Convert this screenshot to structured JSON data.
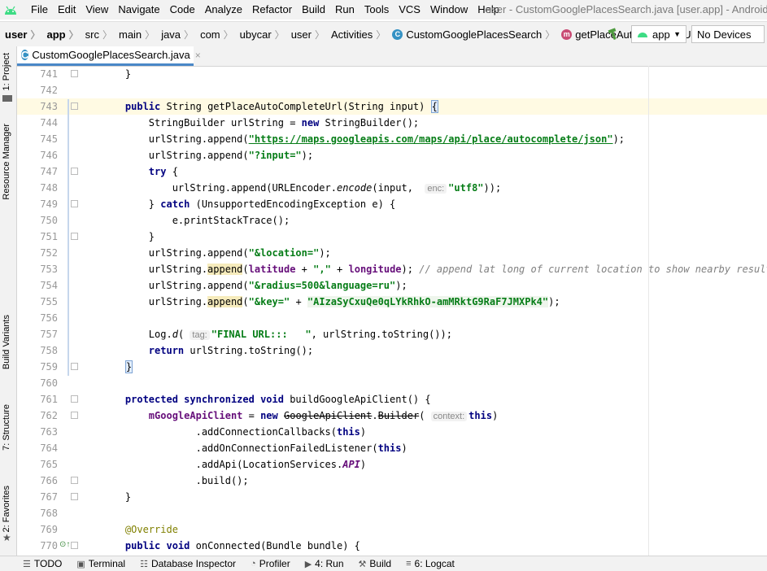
{
  "menu": {
    "items": [
      "File",
      "Edit",
      "View",
      "Navigate",
      "Code",
      "Analyze",
      "Refactor",
      "Build",
      "Run",
      "Tools",
      "VCS",
      "Window",
      "Help"
    ],
    "window_title": "user - CustomGooglePlacesSearch.java [user.app] - Android Studio"
  },
  "breadcrumb": {
    "items": [
      "user",
      "app",
      "src",
      "main",
      "java",
      "com",
      "ubycar",
      "user",
      "Activities",
      "CustomGooglePlacesSearch",
      "getPlaceAutoCompleteUrl"
    ]
  },
  "toolbar": {
    "run_config": "app",
    "device": "No Devices"
  },
  "editor_tab": {
    "label": "CustomGooglePlacesSearch.java",
    "close": "×"
  },
  "left_strip": {
    "project": "1: Project",
    "resource_manager": "Resource Manager",
    "build_variants": "Build Variants",
    "structure": "7: Structure",
    "favorites": "2: Favorites"
  },
  "code": {
    "line_numbers": [
      "741",
      "742",
      "743",
      "744",
      "745",
      "746",
      "747",
      "748",
      "749",
      "750",
      "751",
      "752",
      "753",
      "754",
      "755",
      "756",
      "757",
      "758",
      "759",
      "760",
      "761",
      "762",
      "763",
      "764",
      "765",
      "766",
      "767",
      "768",
      "769",
      "770"
    ],
    "s_url": "\"https://maps.googleapis.com/maps/api/place/autocomplete/json\"",
    "s_input": "\"?input=\"",
    "s_utf8": "\"utf8\"",
    "s_location": "\"&location=\"",
    "s_comma": "\",\"",
    "comment_753": "// append lat long of current location to show nearby results.",
    "s_radius": "\"&radius=500&language=ru\"",
    "s_key": "\"&key=\"",
    "s_apikey": "\"AIzaSyCxuQe0qLYkRhkO-amMRktG9RaF7JMXPk4\"",
    "s_final": "\"FINAL URL:::   \"",
    "hint_enc": "enc:",
    "hint_tag": "tag:",
    "hint_context": "context:"
  },
  "status": {
    "todo": "TODO",
    "terminal": "Terminal",
    "database": "Database Inspector",
    "profiler": "Profiler",
    "run": "4: Run",
    "build": "Build",
    "logcat": "6: Logcat"
  },
  "colors": {
    "keyword": "#000080",
    "string": "#067d17",
    "field": "#660e7a",
    "comment": "#808080",
    "annotation": "#808000",
    "accent": "#4a88c7"
  }
}
